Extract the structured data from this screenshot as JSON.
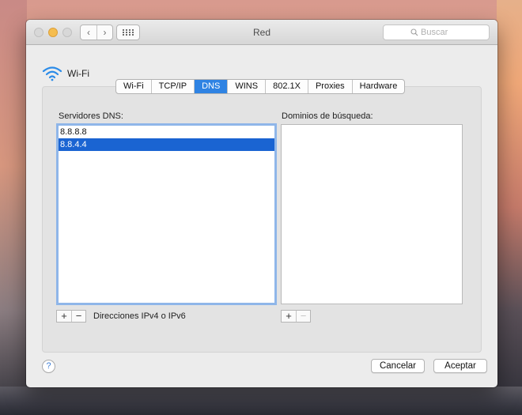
{
  "window": {
    "title": "Red",
    "search_placeholder": "Buscar"
  },
  "interface": {
    "name": "Wi-Fi"
  },
  "tabs": [
    {
      "label": "Wi-Fi",
      "active": false
    },
    {
      "label": "TCP/IP",
      "active": false
    },
    {
      "label": "DNS",
      "active": true
    },
    {
      "label": "WINS",
      "active": false
    },
    {
      "label": "802.1X",
      "active": false
    },
    {
      "label": "Proxies",
      "active": false
    },
    {
      "label": "Hardware",
      "active": false
    }
  ],
  "dns_servers": {
    "label": "Servidores DNS:",
    "items": [
      "8.8.8.8",
      "8.8.4.4"
    ],
    "selected_item": "8.8.4.4",
    "hint": "Direcciones IPv4 o IPv6"
  },
  "search_domains": {
    "label": "Dominios de búsqueda:",
    "items": []
  },
  "controls": {
    "add": "+",
    "remove": "−",
    "help": "?"
  },
  "buttons": {
    "cancel": "Cancelar",
    "ok": "Aceptar"
  },
  "colors": {
    "accent": "#2f83e3",
    "selection": "#1a64d2",
    "focus_ring": "#8fb6e9",
    "minimize_light": "#f5bd4f"
  }
}
